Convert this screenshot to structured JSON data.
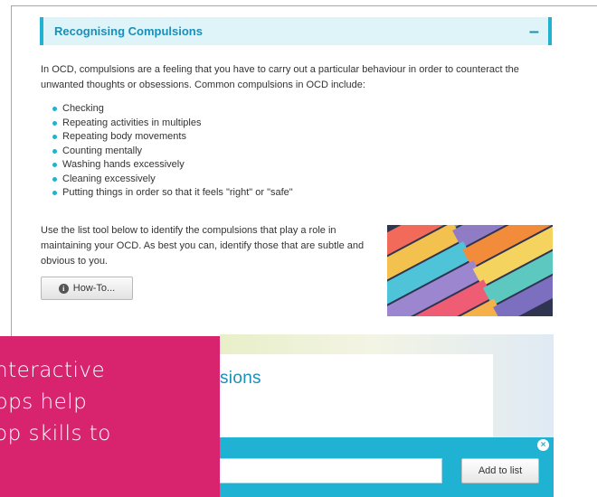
{
  "section": {
    "title": "Recognising Compulsions",
    "toggle": "–",
    "intro": "In OCD, compulsions are a feeling that you have to carry out a particular behaviour in order to counteract the unwanted thoughts or obsessions. Common compulsions in OCD include:",
    "bullets": [
      "Checking",
      "Repeating activities in multiples",
      "Repeating body movements",
      "Counting mentally",
      "Washing hands excessively",
      "Cleaning excessively",
      "Putting things in order so that it feels \"right\" or \"safe\""
    ],
    "instructions": "Use the list tool below to identify the compulsions that play a role in maintaining your OCD. As best you can, identify those that are subtle and obvious to you.",
    "howto_label": "How-To...",
    "info_icon": "info-icon",
    "photo_alt": "colorful-sticky-notes-photo"
  },
  "list_tool": {
    "title_fragment": "sions",
    "input_value": "",
    "add_label": "Add to list",
    "close_icon": "close-icon"
  },
  "caption": {
    "text": "nteractive\npps help\nop skills to"
  },
  "colors": {
    "accent": "#1fb2d3",
    "title_blue": "#1a8fb8",
    "header_bg": "#dff4f8",
    "caption_bg": "#d8246f"
  }
}
